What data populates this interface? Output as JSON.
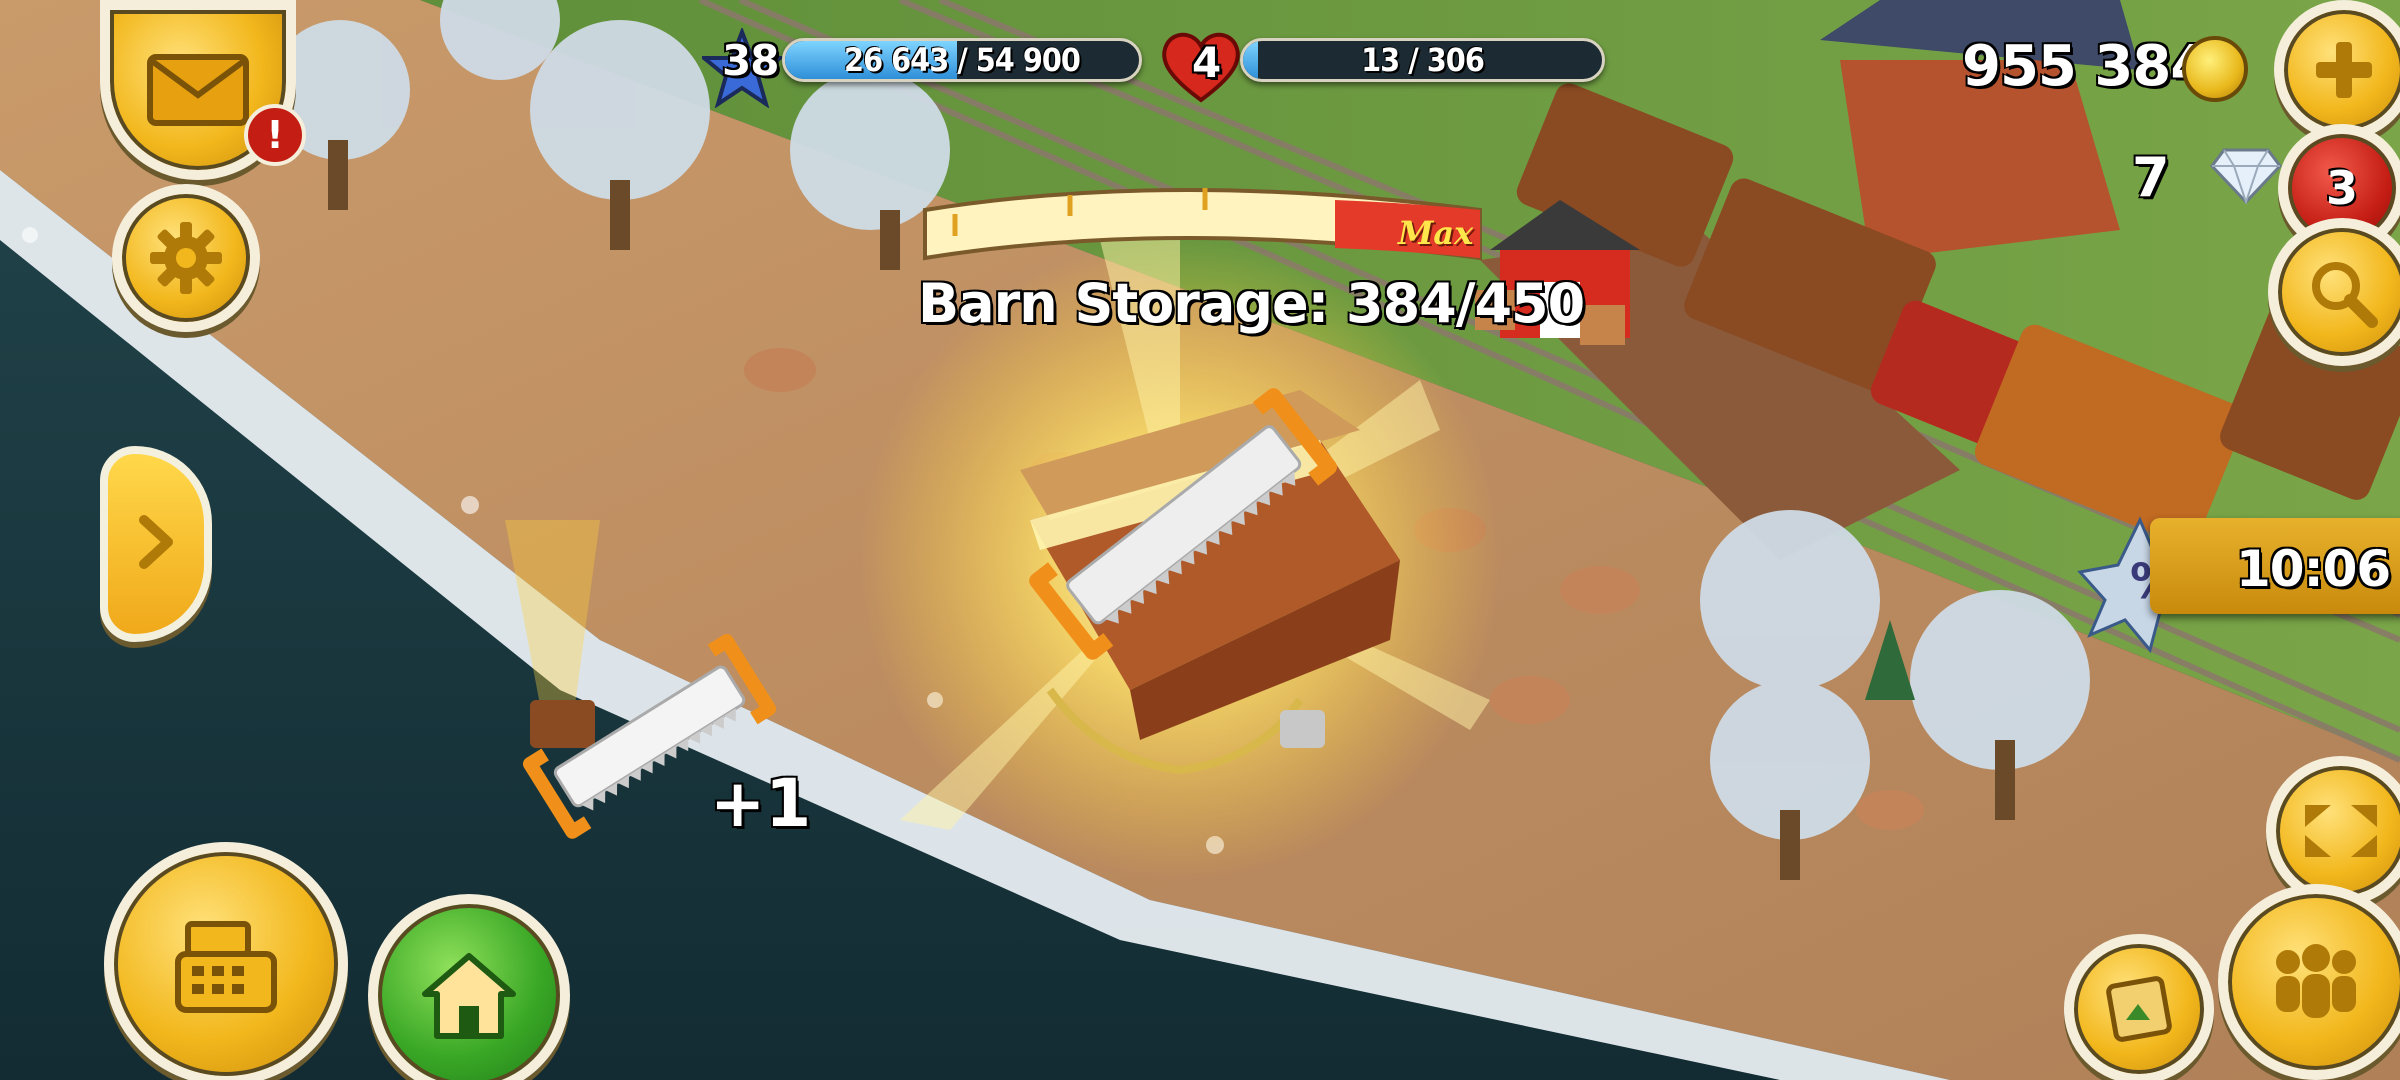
{
  "hud": {
    "level": "38",
    "xp_text": "26 643 / 54 900",
    "xp_progress": 0.485,
    "hearts": "4",
    "reputation_text": "13 / 306",
    "reputation_progress": 0.042,
    "coins": "955 384",
    "diamonds": "7",
    "notifications_badge": "3"
  },
  "storage": {
    "label": "Barn Storage: 384/450",
    "max_label": "Max",
    "fill_fraction": 0.853
  },
  "reward": {
    "item": "saw",
    "amount_text": "+1"
  },
  "sale": {
    "timer_text": "10:06"
  },
  "icons": {
    "mail": "envelope-icon",
    "settings": "gear-icon",
    "shop": "cash-register-icon",
    "home": "house-icon",
    "add": "plus-icon",
    "search": "magnifier-icon",
    "friends": "people-icon",
    "expand": "arrows-icon",
    "albums": "photo-album-icon"
  },
  "colors": {
    "gold_button": "#f2b71c",
    "home_button": "#3aa826",
    "alert_red": "#c41d14",
    "xp_blue": "#2e8fd8",
    "max_red": "#e43a2a"
  }
}
